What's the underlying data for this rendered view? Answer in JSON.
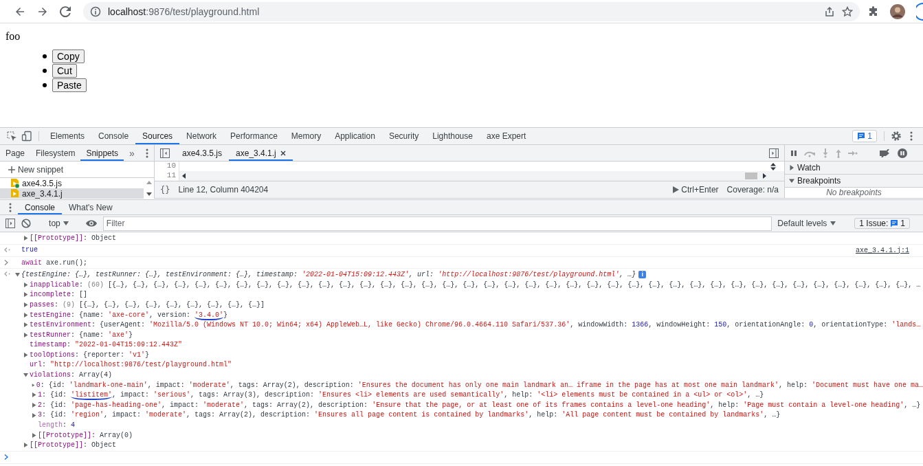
{
  "browser": {
    "url_host": "localhost",
    "url_path": ":9876/test/playground.html"
  },
  "page": {
    "paragraph": "foo",
    "buttons": [
      "Copy",
      "Cut",
      "Paste"
    ]
  },
  "devtools": {
    "tabs": [
      {
        "label": "Elements",
        "selected": false
      },
      {
        "label": "Console",
        "selected": false
      },
      {
        "label": "Sources",
        "selected": true
      },
      {
        "label": "Network",
        "selected": false
      },
      {
        "label": "Performance",
        "selected": false
      },
      {
        "label": "Memory",
        "selected": false
      },
      {
        "label": "Application",
        "selected": false
      },
      {
        "label": "Security",
        "selected": false
      },
      {
        "label": "Lighthouse",
        "selected": false
      },
      {
        "label": "axe Expert",
        "selected": false
      }
    ],
    "issues_badge": "1",
    "navigator": {
      "tabs": [
        {
          "label": "Page",
          "selected": false
        },
        {
          "label": "Filesystem",
          "selected": false
        },
        {
          "label": "Snippets",
          "selected": true
        }
      ],
      "more": "»",
      "new_snippet": "New snippet",
      "files": [
        {
          "name": "axe4.3.5.js",
          "selected": false,
          "running": true
        },
        {
          "name": "axe_3.4.1.j",
          "selected": true,
          "running": false
        }
      ]
    },
    "editor": {
      "tabs": [
        {
          "label": "axe4.3.5.js",
          "selected": false
        },
        {
          "label": "axe_3.4.1.j",
          "selected": true
        }
      ],
      "line_numbers": [
        "10",
        "11"
      ],
      "format_button": "{}",
      "position": "Line 12, Column 404204",
      "run_hint": "Ctrl+Enter",
      "coverage": "Coverage: n/a"
    },
    "debugger": {
      "sections": [
        {
          "title": "Watch",
          "expanded": false
        },
        {
          "title": "Breakpoints",
          "expanded": true,
          "empty_message": "No breakpoints"
        }
      ]
    },
    "drawer": {
      "tabs": [
        {
          "label": "Console",
          "selected": true
        },
        {
          "label": "What's New",
          "selected": false
        }
      ]
    },
    "console_toolbar": {
      "context": "top",
      "filter_placeholder": "Filter",
      "levels": "Default levels",
      "issues_label": "1 Issue:",
      "issues_count": "1"
    },
    "console": {
      "entries": [
        {
          "kind": "continuation",
          "nodes": [
            {
              "kind": "property",
              "expandable": true,
              "expanded": false,
              "tokens": [
                {
                  "kind": "key",
                  "text": "[[Prototype]]"
                },
                {
                  "kind": "plain",
                  "text": ": Object"
                }
              ]
            }
          ]
        },
        {
          "kind": "result",
          "source": "axe_3.4.1.j:1",
          "nodes": [
            {
              "kind": "property",
              "expandable": false,
              "tokens": [
                {
                  "kind": "bool",
                  "text": "true"
                }
              ]
            }
          ]
        },
        {
          "kind": "input",
          "nodes": [
            {
              "kind": "property",
              "expandable": false,
              "tokens": [
                {
                  "kind": "keyword",
                  "text": "await"
                },
                {
                  "kind": "plain",
                  "text": " axe.run();"
                }
              ]
            }
          ]
        },
        {
          "kind": "result",
          "nodes": [
            {
              "kind": "summary",
              "expandable": true,
              "expanded": true,
              "info_badge": "i",
              "tokens": [
                {
                  "kind": "plain",
                  "text": "{testEngine: {…}, testRunner: {…}, testEnvironment: {…}, timestamp: "
                },
                {
                  "kind": "str",
                  "text": "'2022-01-04T15:09:12.443Z'"
                },
                {
                  "kind": "plain",
                  "text": ", url: "
                },
                {
                  "kind": "str",
                  "text": "'http://localhost:9876/test/playground.html'"
                },
                {
                  "kind": "plain",
                  "text": ", …}"
                }
              ],
              "children": [
                {
                  "kind": "property",
                  "expandable": true,
                  "expanded": false,
                  "tokens": [
                    {
                      "kind": "key",
                      "text": "inapplicable"
                    },
                    {
                      "kind": "plain",
                      "text": ": "
                    },
                    {
                      "kind": "meta",
                      "text": "(60) "
                    },
                    {
                      "kind": "plain",
                      "text": "[{…}, {…}, {…}, {…}, {…}, {…}, {…}, {…}, {…}, {…}, {…}, {…}, {…}, {…}, {…}, {…}, {…}, {…}, {…}, {…}, {…}, {…}, {…}, {…}, {…}, {…}, {…}, {…}, {…}, {…}, {…}, {…}, {…}, {…}, {…}, {…}, {…}, {…}, {…}, …"
                    }
                  ]
                },
                {
                  "kind": "property",
                  "expandable": true,
                  "expanded": false,
                  "tokens": [
                    {
                      "kind": "key",
                      "text": "incomplete"
                    },
                    {
                      "kind": "plain",
                      "text": ": []"
                    }
                  ]
                },
                {
                  "kind": "property",
                  "expandable": true,
                  "expanded": false,
                  "tokens": [
                    {
                      "kind": "key",
                      "text": "passes"
                    },
                    {
                      "kind": "plain",
                      "text": ": "
                    },
                    {
                      "kind": "meta",
                      "text": "(9) "
                    },
                    {
                      "kind": "plain",
                      "text": "[{…}, {…}, {…}, {…}, {…}, {…}, {…}, {…}, {…}]"
                    }
                  ]
                },
                {
                  "kind": "property",
                  "expandable": true,
                  "expanded": false,
                  "tokens": [
                    {
                      "kind": "key",
                      "text": "testEngine"
                    },
                    {
                      "kind": "plain",
                      "text": ": {name: "
                    },
                    {
                      "kind": "str",
                      "text": "'axe-core'"
                    },
                    {
                      "kind": "plain",
                      "text": ", version: "
                    },
                    {
                      "kind": "str",
                      "text": "'3.4.0'",
                      "underlined": true
                    },
                    {
                      "kind": "plain",
                      "text": "}"
                    }
                  ]
                },
                {
                  "kind": "property",
                  "expandable": true,
                  "expanded": false,
                  "tokens": [
                    {
                      "kind": "key",
                      "text": "testEnvironment"
                    },
                    {
                      "kind": "plain",
                      "text": ": {userAgent: "
                    },
                    {
                      "kind": "str",
                      "text": "'Mozilla/5.0 (Windows NT 10.0; Win64; x64) AppleWeb…L, like Gecko) Chrome/96.0.4664.110 Safari/537.36'"
                    },
                    {
                      "kind": "plain",
                      "text": ", windowWidth: "
                    },
                    {
                      "kind": "num",
                      "text": "1366"
                    },
                    {
                      "kind": "plain",
                      "text": ", windowHeight: "
                    },
                    {
                      "kind": "num",
                      "text": "150"
                    },
                    {
                      "kind": "plain",
                      "text": ", orientationAngle: "
                    },
                    {
                      "kind": "num",
                      "text": "0"
                    },
                    {
                      "kind": "plain",
                      "text": ", orientationType: "
                    },
                    {
                      "kind": "str",
                      "text": "'lands…"
                    }
                  ]
                },
                {
                  "kind": "property",
                  "expandable": true,
                  "expanded": false,
                  "tokens": [
                    {
                      "kind": "key",
                      "text": "testRunner"
                    },
                    {
                      "kind": "plain",
                      "text": ": {name: "
                    },
                    {
                      "kind": "str",
                      "text": "'axe'"
                    },
                    {
                      "kind": "plain",
                      "text": "}"
                    }
                  ]
                },
                {
                  "kind": "property",
                  "expandable": false,
                  "tokens": [
                    {
                      "kind": "key",
                      "text": "timestamp"
                    },
                    {
                      "kind": "plain",
                      "text": ": "
                    },
                    {
                      "kind": "str",
                      "text": "\"2022-01-04T15:09:12.443Z\""
                    }
                  ]
                },
                {
                  "kind": "property",
                  "expandable": true,
                  "expanded": false,
                  "tokens": [
                    {
                      "kind": "key",
                      "text": "toolOptions"
                    },
                    {
                      "kind": "plain",
                      "text": ": {reporter: "
                    },
                    {
                      "kind": "str",
                      "text": "'v1'"
                    },
                    {
                      "kind": "plain",
                      "text": "}"
                    }
                  ]
                },
                {
                  "kind": "property",
                  "expandable": false,
                  "tokens": [
                    {
                      "kind": "key",
                      "text": "url"
                    },
                    {
                      "kind": "plain",
                      "text": ": "
                    },
                    {
                      "kind": "str",
                      "text": "\"http://localhost:9876/test/playground.html\""
                    }
                  ]
                },
                {
                  "kind": "property",
                  "expandable": true,
                  "expanded": true,
                  "tokens": [
                    {
                      "kind": "key",
                      "text": "violations"
                    },
                    {
                      "kind": "plain",
                      "text": ": Array(4)"
                    }
                  ],
                  "children": [
                    {
                      "kind": "property",
                      "expandable": true,
                      "expanded": false,
                      "tokens": [
                        {
                          "kind": "key",
                          "text": "0"
                        },
                        {
                          "kind": "plain",
                          "text": ": {id: "
                        },
                        {
                          "kind": "str",
                          "text": "'landmark-one-main'"
                        },
                        {
                          "kind": "plain",
                          "text": ", impact: "
                        },
                        {
                          "kind": "str",
                          "text": "'moderate'"
                        },
                        {
                          "kind": "plain",
                          "text": ", tags: Array(2), description: "
                        },
                        {
                          "kind": "str",
                          "text": "'Ensures the document has only one main landmark an… iframe in the page has at most one main landmark'"
                        },
                        {
                          "kind": "plain",
                          "text": ", help: "
                        },
                        {
                          "kind": "str",
                          "text": "'Document must have one ma…"
                        }
                      ]
                    },
                    {
                      "kind": "property",
                      "expandable": true,
                      "expanded": false,
                      "tokens": [
                        {
                          "kind": "key",
                          "text": "1"
                        },
                        {
                          "kind": "plain",
                          "text": ": {id: "
                        },
                        {
                          "kind": "str",
                          "text": "'listitem'",
                          "underlined": true
                        },
                        {
                          "kind": "plain",
                          "text": ", impact: "
                        },
                        {
                          "kind": "str",
                          "text": "'serious'"
                        },
                        {
                          "kind": "plain",
                          "text": ", tags: Array(3), description: "
                        },
                        {
                          "kind": "str",
                          "text": "'Ensures <li> elements are used semantically'"
                        },
                        {
                          "kind": "plain",
                          "text": ", help: "
                        },
                        {
                          "kind": "str",
                          "text": "'<li> elements must be contained in a <ul> or <ol>'"
                        },
                        {
                          "kind": "plain",
                          "text": ", …}"
                        }
                      ]
                    },
                    {
                      "kind": "property",
                      "expandable": true,
                      "expanded": false,
                      "tokens": [
                        {
                          "kind": "key",
                          "text": "2"
                        },
                        {
                          "kind": "plain",
                          "text": ": {id: "
                        },
                        {
                          "kind": "str",
                          "text": "'page-has-heading-one'"
                        },
                        {
                          "kind": "plain",
                          "text": ", impact: "
                        },
                        {
                          "kind": "str",
                          "text": "'moderate'"
                        },
                        {
                          "kind": "plain",
                          "text": ", tags: Array(2), description: "
                        },
                        {
                          "kind": "str",
                          "text": "'Ensure that the page, or at least one of its frames contains a level-one heading'"
                        },
                        {
                          "kind": "plain",
                          "text": ", help: "
                        },
                        {
                          "kind": "str",
                          "text": "'Page must contain a level-one heading'"
                        },
                        {
                          "kind": "plain",
                          "text": ", …}"
                        }
                      ]
                    },
                    {
                      "kind": "property",
                      "expandable": true,
                      "expanded": false,
                      "tokens": [
                        {
                          "kind": "key",
                          "text": "3"
                        },
                        {
                          "kind": "plain",
                          "text": ": {id: "
                        },
                        {
                          "kind": "str",
                          "text": "'region'"
                        },
                        {
                          "kind": "plain",
                          "text": ", impact: "
                        },
                        {
                          "kind": "str",
                          "text": "'moderate'"
                        },
                        {
                          "kind": "plain",
                          "text": ", tags: Array(2), description: "
                        },
                        {
                          "kind": "str",
                          "text": "'Ensures all page content is contained by landmarks'"
                        },
                        {
                          "kind": "plain",
                          "text": ", help: "
                        },
                        {
                          "kind": "str",
                          "text": "'All page content must be contained by landmarks'"
                        },
                        {
                          "kind": "plain",
                          "text": ", …}"
                        }
                      ]
                    },
                    {
                      "kind": "property",
                      "expandable": false,
                      "tokens": [
                        {
                          "kind": "dim-key",
                          "text": "length"
                        },
                        {
                          "kind": "plain",
                          "text": ": "
                        },
                        {
                          "kind": "num",
                          "text": "4"
                        }
                      ]
                    },
                    {
                      "kind": "property",
                      "expandable": true,
                      "expanded": false,
                      "tokens": [
                        {
                          "kind": "key",
                          "text": "[[Prototype]]"
                        },
                        {
                          "kind": "plain",
                          "text": ": Array(0)"
                        }
                      ]
                    }
                  ]
                },
                {
                  "kind": "property",
                  "expandable": true,
                  "expanded": false,
                  "tokens": [
                    {
                      "kind": "key",
                      "text": "[[Prototype]]"
                    },
                    {
                      "kind": "plain",
                      "text": ": Object"
                    }
                  ]
                }
              ]
            }
          ]
        },
        {
          "kind": "prompt"
        }
      ]
    }
  }
}
